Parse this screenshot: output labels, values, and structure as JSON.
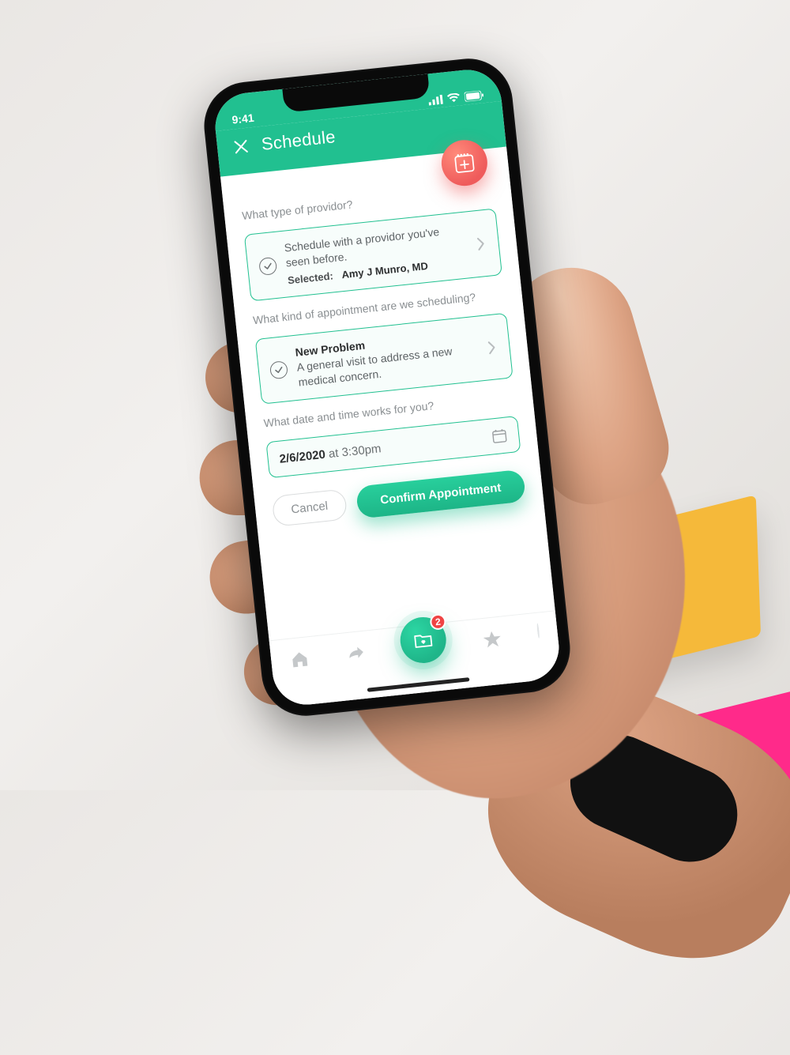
{
  "status": {
    "time": "9:41"
  },
  "header": {
    "title": "Schedule"
  },
  "fab": {
    "icon": "calendar-plus-icon"
  },
  "q1": {
    "label": "What type of providor?",
    "card_text": "Schedule with a providor you've seen before.",
    "selected_label": "Selected:",
    "selected_value": "Amy J Munro, MD"
  },
  "q2": {
    "label": "What kind of appointment are we scheduling?",
    "title": "New Problem",
    "desc": "A general visit to address a new medical concern."
  },
  "q3": {
    "label": "What date and time works for you?",
    "date": "2/6/2020",
    "joiner": "at",
    "time": "3:30pm"
  },
  "buttons": {
    "cancel": "Cancel",
    "confirm": "Confirm Appointment"
  },
  "nav": {
    "badge": "2"
  },
  "colors": {
    "primary": "#21c090",
    "accent": "#ef5b5b"
  }
}
